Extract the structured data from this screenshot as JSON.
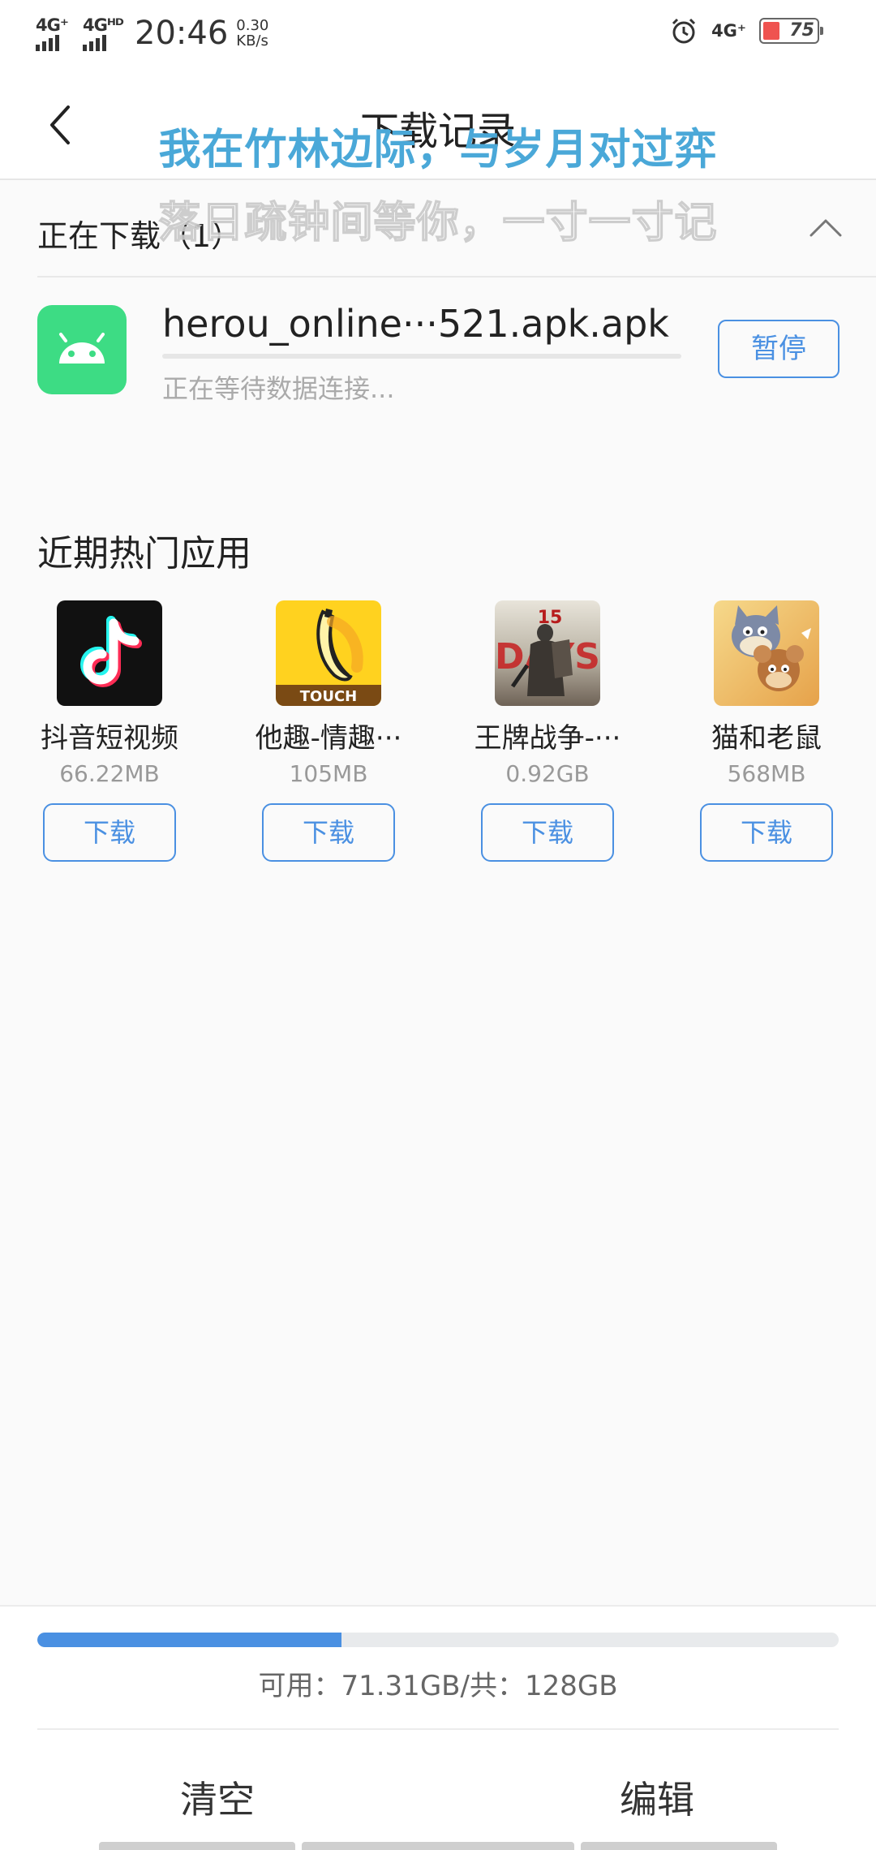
{
  "status_bar": {
    "network1": "4G⁺",
    "network2": "4Gᴴᴰ",
    "time": "20:46",
    "speed_value": "0.30",
    "speed_unit": "KB/s",
    "network3": "4G⁺",
    "battery": "75"
  },
  "header": {
    "title": "下载记录"
  },
  "overlay": {
    "line1": "我在竹林边际，与岁月对过弈",
    "line2": "落日疏钟间等你，一寸一寸记"
  },
  "downloading": {
    "section_label": "正在下载（1）",
    "item": {
      "name": "herou_online···521.apk.apk",
      "status": "正在等待数据连接...",
      "pause_label": "暂停",
      "progress": 0.0
    }
  },
  "hot_apps": {
    "title": "近期热门应用",
    "items": [
      {
        "name": "抖音短视频",
        "size": "66.22MB",
        "button": "下载"
      },
      {
        "name": "他趣-情趣···",
        "size": "105MB",
        "button": "下载",
        "icon_text": "TOUCH"
      },
      {
        "name": "王牌战争-···",
        "size": "0.92GB",
        "button": "下载",
        "icon_text": "DAYS",
        "icon_number": "15"
      },
      {
        "name": "猫和老鼠",
        "size": "568MB",
        "button": "下载"
      }
    ]
  },
  "storage": {
    "text": "可用：71.31GB/共：128GB",
    "used_fraction": 0.38
  },
  "bottom_actions": {
    "clear": "清空",
    "edit": "编辑"
  },
  "colors": {
    "accent": "#4a90e2",
    "android_green": "#3ddc84"
  }
}
